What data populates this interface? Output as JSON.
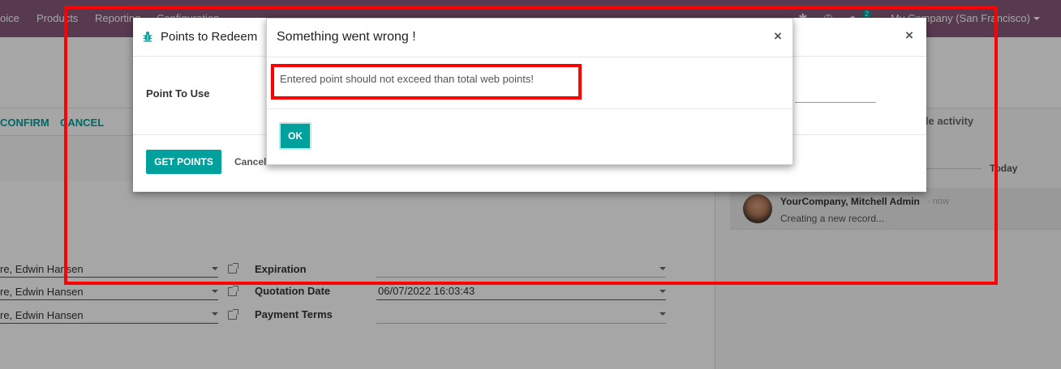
{
  "topbar": {
    "menu": [
      "oice",
      "Products",
      "Reporting",
      "Configuration"
    ],
    "company": "My Company (San Francisco)",
    "message_count": "2"
  },
  "statusbar": {
    "confirm": "CONFIRM",
    "cancel": "CANCEL"
  },
  "form": {
    "customer_rows": [
      "re, Edwin Hansen",
      "re, Edwin Hansen",
      "re, Edwin Hansen"
    ],
    "expiration_label": "Expiration",
    "quotation_date_label": "Quotation Date",
    "quotation_date_value": "06/07/2022 16:03:43",
    "payment_terms_label": "Payment Terms"
  },
  "chatter": {
    "schedule_activity": "dule activity",
    "today": "Today",
    "author": "YourCompany, Mitchell Admin",
    "ago": "- now",
    "body": "Creating a new record..."
  },
  "redeem_dialog": {
    "title": "Points to Redeem",
    "field_label": "Point To Use",
    "get_points": "GET POINTS",
    "cancel": "Cancel"
  },
  "error_dialog": {
    "title": "Something went wrong !",
    "message": "Entered point should not exceed than total web points!",
    "ok": "OK"
  },
  "colors": {
    "brand": "#875a7b",
    "accent": "#00a09d",
    "annotation": "#ff0000"
  }
}
